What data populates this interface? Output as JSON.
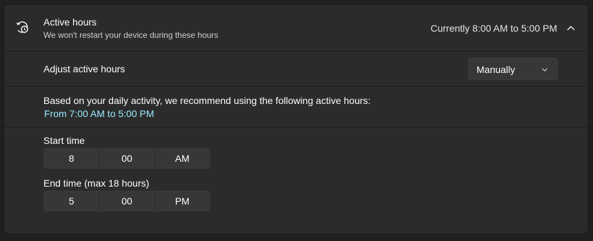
{
  "header": {
    "title": "Active hours",
    "subtitle": "We won't restart your device during these hours",
    "status": "Currently 8:00 AM to 5:00 PM",
    "icon": "clock-restart-icon",
    "expand_icon": "chevron-up-icon"
  },
  "adjust": {
    "label": "Adjust active hours",
    "dropdown_value": "Manually"
  },
  "recommendation": {
    "text": "Based on your daily activity, we recommend using the following active hours:",
    "link": "From 7:00 AM to 5:00 PM"
  },
  "start_time": {
    "label": "Start time",
    "hour": "8",
    "minute": "00",
    "period": "AM"
  },
  "end_time": {
    "label": "End time (max 18 hours)",
    "hour": "5",
    "minute": "00",
    "period": "PM"
  },
  "colors": {
    "background": "#202020",
    "panel": "#2b2b2b",
    "accent_link": "#99ebff"
  }
}
